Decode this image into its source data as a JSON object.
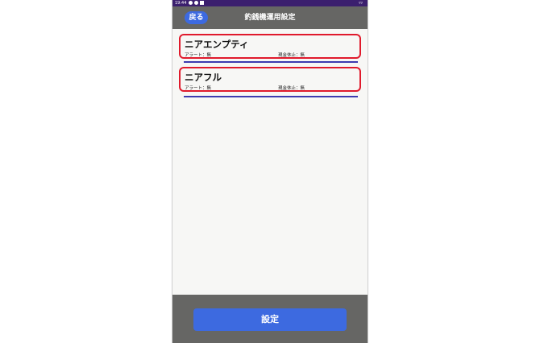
{
  "status_bar": {
    "time": "19:44",
    "right": "▿▿"
  },
  "header": {
    "back_label": "戻る",
    "title": "釣銭機運用設定"
  },
  "items": [
    {
      "name": "ニアエンプティ",
      "alert": "アラート：無",
      "stop": "現金休止：無"
    },
    {
      "name": "ニアフル",
      "alert": "アラート：無",
      "stop": "現金休止：無"
    }
  ],
  "footer": {
    "set_label": "設定"
  },
  "colors": {
    "accent": "#3d6ae0",
    "highlight": "#e01a2c",
    "bar": "#666664",
    "status": "#3b1f6e"
  }
}
